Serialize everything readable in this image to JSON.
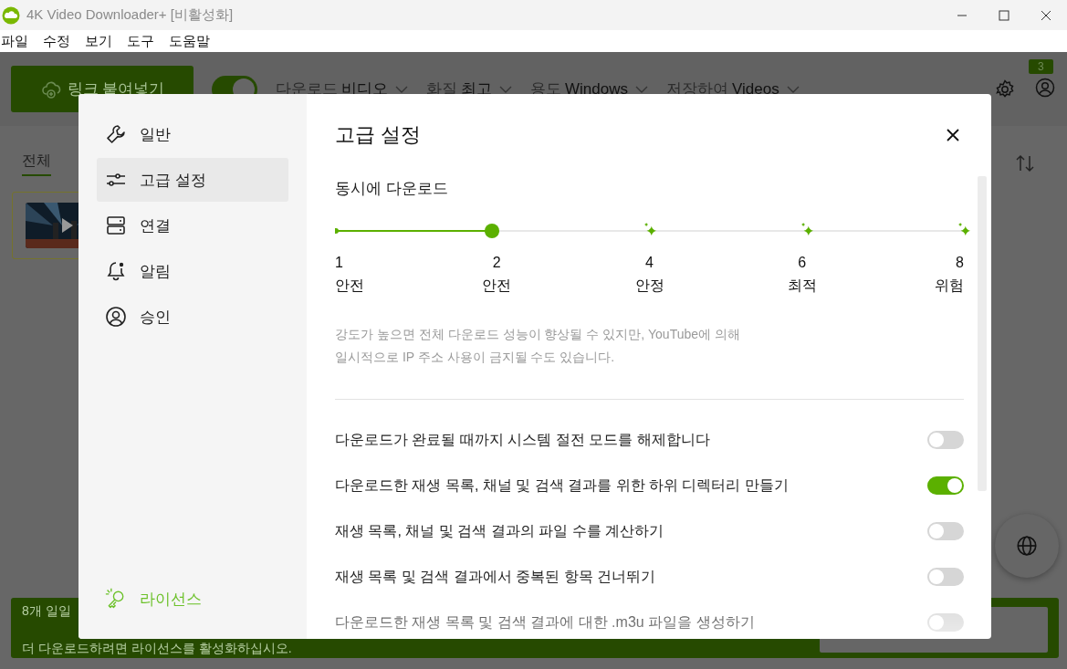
{
  "window": {
    "title": "4K Video Downloader+ [비활성화]"
  },
  "menu": [
    "파일",
    "수정",
    "보기",
    "도구",
    "도움말"
  ],
  "toolbar": {
    "paste_button": "링크 붙여넣기",
    "smart_mode": {
      "on": true
    },
    "dropdowns": [
      {
        "label": "다운로드",
        "value": "비디오"
      },
      {
        "label": "화질",
        "value": "최고"
      },
      {
        "label": "용도",
        "value": "Windows"
      },
      {
        "label": "저장하여",
        "value": "Videos"
      }
    ],
    "notification_count": "3"
  },
  "tabs": [
    {
      "label": "전체",
      "selected": true
    }
  ],
  "banner": {
    "line_1": "8개 일일",
    "line_2": "더 다운로드하려면 라이선스를 활성화하십시오."
  },
  "dialog": {
    "sidebar": [
      {
        "label": "일반",
        "selected": false
      },
      {
        "label": "고급 설정",
        "selected": true
      },
      {
        "label": "연결",
        "selected": false
      },
      {
        "label": "알림",
        "selected": false
      },
      {
        "label": "승인",
        "selected": false
      }
    ],
    "license": "라이선스",
    "title": "고급 설정",
    "section": "동시에 다운로드",
    "slider": {
      "level": 0.25,
      "steps": [
        {
          "value": "1",
          "label": "안전",
          "sparkle": false
        },
        {
          "value": "2",
          "label": "안전",
          "sparkle": false
        },
        {
          "value": "4",
          "label": "안정",
          "sparkle": true
        },
        {
          "value": "6",
          "label": "최적",
          "sparkle": true
        },
        {
          "value": "8",
          "label": "위험",
          "sparkle": true
        }
      ]
    },
    "hint": "강도가 높으면 전체 다운로드 성능이 향상될 수 있지만, YouTube에 의해 일시적으로 IP 주소 사용이 금지될 수도 있습니다.",
    "options": [
      {
        "label": "다운로드가 완료될 때까지 시스템 절전 모드를 해제합니다",
        "on": false
      },
      {
        "label": "다운로드한 재생 목록, 채널 및 검색 결과를 위한 하위 디렉터리 만들기",
        "on": true
      },
      {
        "label": "재생 목록, 채널 및 검색 결과의 파일 수를 계산하기",
        "on": false
      },
      {
        "label": "재생 목록 및 검색 결과에서 중복된 항목 건너뛰기",
        "on": false
      },
      {
        "label": "다운로드한 재생 목록 및 검색 결과에 대한 .m3u 파일을 생성하기",
        "on": false
      }
    ]
  }
}
